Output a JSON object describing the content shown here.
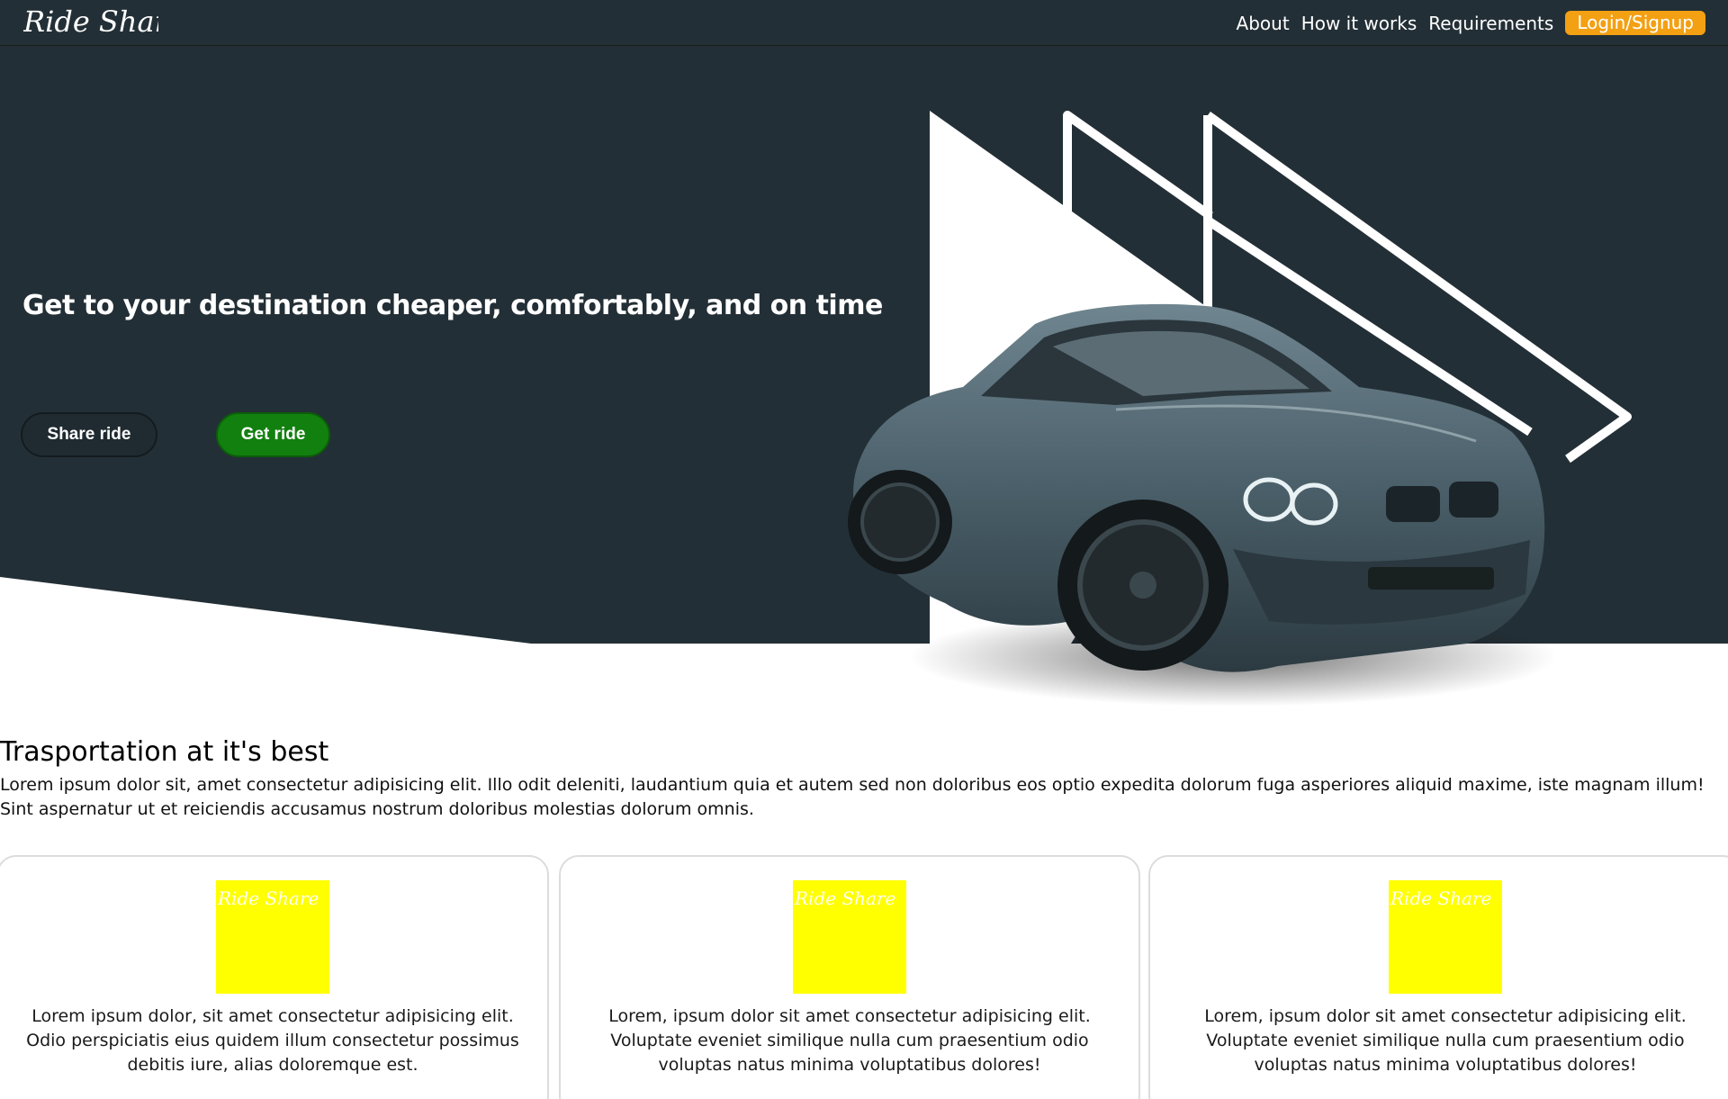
{
  "nav": {
    "logo_text": "Ride Share",
    "links": [
      "About",
      "How it works",
      "Requirements"
    ],
    "login_label": "Login/Signup"
  },
  "hero": {
    "title": "Get to your destination cheaper, comfortably, and on time",
    "share_button": "Share ride",
    "get_button": "Get ride"
  },
  "section": {
    "title": "Trasportation at it's best",
    "text": "Lorem ipsum dolor sit, amet consectetur adipisicing elit. Illo odit deleniti, laudantium quia et autem sed non doloribus eos optio expedita dolorum fuga asperiores aliquid maxime, iste magnam illum! Sint aspernatur ut et reiciendis accusamus nostrum doloribus molestias dolorum omnis."
  },
  "cards": [
    {
      "image_text": "Ride Share",
      "text": "Lorem ipsum dolor, sit amet consectetur adipisicing elit. Odio perspiciatis eius quidem illum consectetur possimus debitis iure, alias doloremque est."
    },
    {
      "image_text": "Ride Share",
      "text": "Lorem, ipsum dolor sit amet consectetur adipisicing elit. Voluptate eveniet similique nulla cum praesentium odio voluptas natus minima voluptatibus dolores!"
    },
    {
      "image_text": "Ride Share",
      "text": "Lorem, ipsum dolor sit amet consectetur adipisicing elit. Voluptate eveniet similique nulla cum praesentium odio voluptas natus minima voluptatibus dolores!"
    }
  ],
  "colors": {
    "navbar": "#232f36",
    "hero_bg": "#232f36",
    "login_button": "#f3a013",
    "get_ride_button": "#12800f",
    "card_image": "#ffff00"
  }
}
